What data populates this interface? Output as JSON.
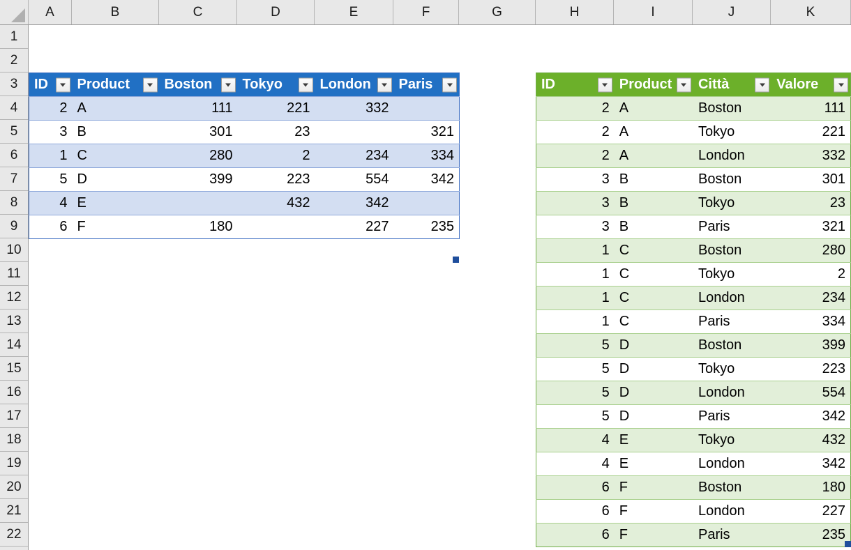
{
  "app": {
    "kind": "spreadsheet-grid",
    "select_all_icon": "select-all-triangle"
  },
  "grid": {
    "column_headers": [
      "A",
      "B",
      "C",
      "D",
      "E",
      "F",
      "G",
      "H",
      "I",
      "J",
      "K"
    ],
    "row_headers": [
      "1",
      "2",
      "3",
      "4",
      "5",
      "6",
      "7",
      "8",
      "9",
      "10",
      "11",
      "12",
      "13",
      "14",
      "15",
      "16",
      "17",
      "18",
      "19",
      "20",
      "21",
      "22"
    ]
  },
  "colors": {
    "blue_header": "#2170c4",
    "blue_band": "#d3def2",
    "blue_border": "#4472c4",
    "green_header": "#6cb02a",
    "green_band": "#e2efd9",
    "green_border": "#70ad47",
    "header_strip": "#e8e8e8",
    "fill_handle": "#1f4e9c"
  },
  "icons": {
    "filter_dropdown": "filter-dropdown-icon",
    "select_all": "select-all-icon",
    "fill_handle": "fill-handle-icon"
  },
  "table_blue": {
    "name": "wide-source-table",
    "headers": [
      "ID",
      "Product",
      "Boston",
      "Tokyo",
      "London",
      "Paris"
    ],
    "rows": [
      {
        "id": "2",
        "product": "A",
        "boston": "111",
        "tokyo": "221",
        "london": "332",
        "paris": ""
      },
      {
        "id": "3",
        "product": "B",
        "boston": "301",
        "tokyo": "23",
        "london": "",
        "paris": "321"
      },
      {
        "id": "1",
        "product": "C",
        "boston": "280",
        "tokyo": "2",
        "london": "234",
        "paris": "334"
      },
      {
        "id": "5",
        "product": "D",
        "boston": "399",
        "tokyo": "223",
        "london": "554",
        "paris": "342"
      },
      {
        "id": "4",
        "product": "E",
        "boston": "",
        "tokyo": "432",
        "london": "342",
        "paris": ""
      },
      {
        "id": "6",
        "product": "F",
        "boston": "180",
        "tokyo": "",
        "london": "227",
        "paris": "235"
      }
    ]
  },
  "table_green": {
    "name": "unpivoted-result-table",
    "headers": [
      "ID",
      "Product",
      "Città",
      "Valore"
    ],
    "rows": [
      {
        "id": "2",
        "product": "A",
        "citta": "Boston",
        "valore": "111"
      },
      {
        "id": "2",
        "product": "A",
        "citta": "Tokyo",
        "valore": "221"
      },
      {
        "id": "2",
        "product": "A",
        "citta": "London",
        "valore": "332"
      },
      {
        "id": "3",
        "product": "B",
        "citta": "Boston",
        "valore": "301"
      },
      {
        "id": "3",
        "product": "B",
        "citta": "Tokyo",
        "valore": "23"
      },
      {
        "id": "3",
        "product": "B",
        "citta": "Paris",
        "valore": "321"
      },
      {
        "id": "1",
        "product": "C",
        "citta": "Boston",
        "valore": "280"
      },
      {
        "id": "1",
        "product": "C",
        "citta": "Tokyo",
        "valore": "2"
      },
      {
        "id": "1",
        "product": "C",
        "citta": "London",
        "valore": "234"
      },
      {
        "id": "1",
        "product": "C",
        "citta": "Paris",
        "valore": "334"
      },
      {
        "id": "5",
        "product": "D",
        "citta": "Boston",
        "valore": "399"
      },
      {
        "id": "5",
        "product": "D",
        "citta": "Tokyo",
        "valore": "223"
      },
      {
        "id": "5",
        "product": "D",
        "citta": "London",
        "valore": "554"
      },
      {
        "id": "5",
        "product": "D",
        "citta": "Paris",
        "valore": "342"
      },
      {
        "id": "4",
        "product": "E",
        "citta": "Tokyo",
        "valore": "432"
      },
      {
        "id": "4",
        "product": "E",
        "citta": "London",
        "valore": "342"
      },
      {
        "id": "6",
        "product": "F",
        "citta": "Boston",
        "valore": "180"
      },
      {
        "id": "6",
        "product": "F",
        "citta": "London",
        "valore": "227"
      },
      {
        "id": "6",
        "product": "F",
        "citta": "Paris",
        "valore": "235"
      }
    ]
  }
}
